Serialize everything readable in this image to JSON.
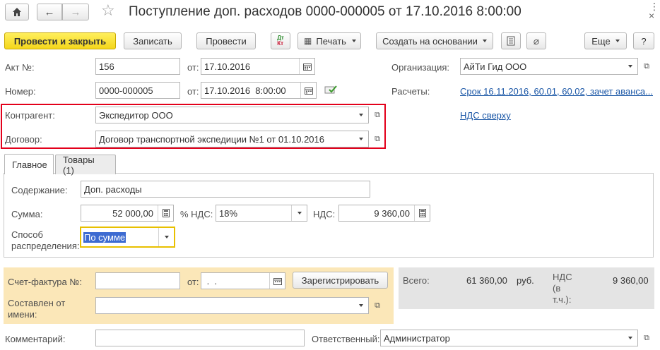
{
  "title": "Поступление доп. расходов 0000-000005 от 17.10.2016 8:00:00",
  "toolbar": {
    "post_close": "Провести и закрыть",
    "save": "Записать",
    "post": "Провести",
    "print": "Печать",
    "create_based": "Создать на основании",
    "more": "Еще",
    "help": "?"
  },
  "header": {
    "act_label": "Акт №:",
    "act_value": "156",
    "from_label": "от:",
    "act_date": "17.10.2016",
    "number_label": "Номер:",
    "number_value": "0000-000005",
    "number_date": "17.10.2016  8:00:00",
    "org_label": "Организация:",
    "org_value": "АйТи Гид ООО",
    "settlements_label": "Расчеты:",
    "settlements_link": "Срок 16.11.2016, 60.01, 60.02, зачет аванса...",
    "vat_link": "НДС сверху",
    "counterparty_label": "Контрагент:",
    "counterparty_value": "Экспедитор ООО",
    "contract_label": "Договор:",
    "contract_value": "Договор транспортной экспедиции №1 от 01.10.2016"
  },
  "tabs": [
    {
      "label": "Главное"
    },
    {
      "label": "Товары (1)"
    }
  ],
  "main": {
    "content_label": "Содержание:",
    "content_value": "Доп. расходы",
    "sum_label": "Сумма:",
    "sum_value": "52 000,00",
    "vat_rate_label": "% НДС:",
    "vat_rate_value": "18%",
    "vat_label": "НДС:",
    "vat_value": "9 360,00",
    "distribution_label_1": "Способ",
    "distribution_label_2": "распределения:",
    "distribution_value": "По сумме"
  },
  "invoice": {
    "invoice_label": "Счет-фактура №:",
    "from_label": "от:",
    "date_value": " .  .",
    "register_button": "Зарегистрировать",
    "composed_label_1": "Составлен от",
    "composed_label_2": "имени:"
  },
  "totals": {
    "total_label": "Всего:",
    "total_value": "61 360,00",
    "currency": "руб.",
    "vat_label_1": "НДС",
    "vat_label_2": "(в",
    "vat_label_3": "т.ч.):",
    "vat_value": "9 360,00"
  },
  "footer": {
    "comment_label": "Комментарий:",
    "responsible_label": "Ответственный:",
    "responsible_value": "Администратор"
  },
  "colors": {
    "primary_button": "#f4d61a",
    "highlight_border": "#e3001b",
    "invoice_panel": "#fbe7b8",
    "totals_panel": "#e4e4e4",
    "link": "#1a56a6",
    "focused_border": "#e8c000",
    "selection": "#3d6bd1"
  }
}
